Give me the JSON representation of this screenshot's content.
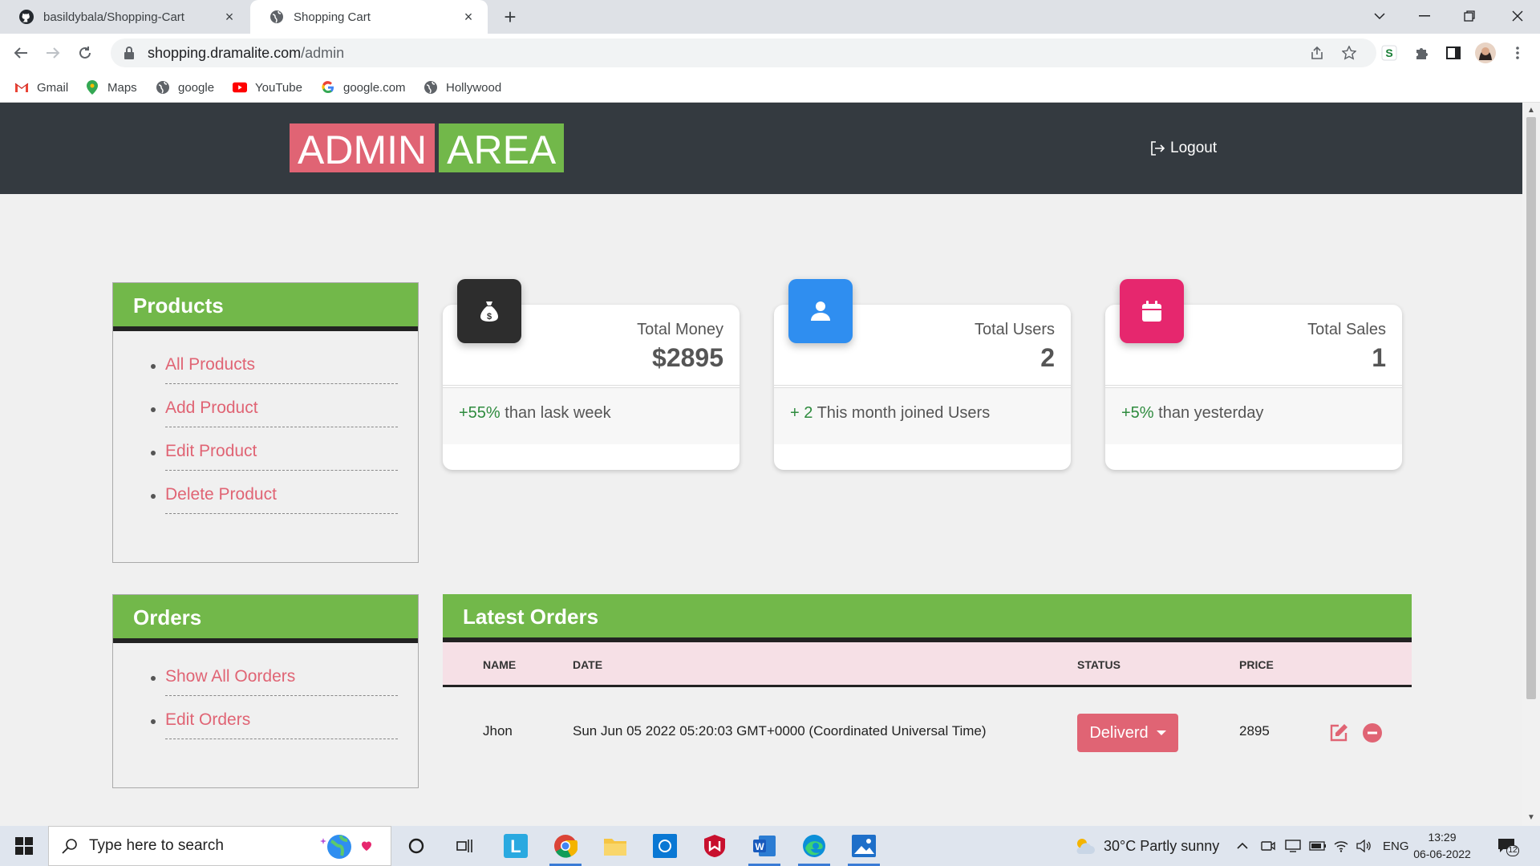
{
  "browser": {
    "tabs": [
      {
        "title": "basildybala/Shopping-Cart",
        "icon": "github-icon"
      },
      {
        "title": "Shopping Cart",
        "icon": "globe-icon",
        "active": true
      }
    ],
    "url_host": "shopping.dramalite.com",
    "url_path": "/admin",
    "bookmarks": [
      {
        "label": "Gmail",
        "icon": "gmail-icon"
      },
      {
        "label": "Maps",
        "icon": "maps-icon"
      },
      {
        "label": "google",
        "icon": "globe-icon"
      },
      {
        "label": "YouTube",
        "icon": "youtube-icon"
      },
      {
        "label": "google.com",
        "icon": "google-icon"
      },
      {
        "label": "Hollywood",
        "icon": "globe-icon"
      }
    ]
  },
  "header": {
    "brand_part1": "ADMIN",
    "brand_part2": "AREA",
    "logout_label": "Logout"
  },
  "products_panel": {
    "title": "Products",
    "items": [
      "All Products",
      "Add Product",
      "Edit Product",
      "Delete Product"
    ]
  },
  "orders_panel": {
    "title": "Orders",
    "items": [
      "Show All Oorders",
      "Edit Orders"
    ]
  },
  "stats": [
    {
      "label": "Total Money",
      "value": "$2895",
      "note_highlight": "+55%",
      "note_rest": "than lask week",
      "icon": "money-bag-icon",
      "color": "#2d2d2d"
    },
    {
      "label": "Total Users",
      "value": "2",
      "note_highlight": "+ 2",
      "note_rest": "This month joined Users",
      "icon": "user-icon",
      "color": "#2f8ef0"
    },
    {
      "label": "Total Sales",
      "value": "1",
      "note_highlight": "+5%",
      "note_rest": "than yesterday",
      "icon": "calendar-icon",
      "color": "#e6276e"
    }
  ],
  "latest_orders": {
    "title": "Latest Orders",
    "columns": [
      "NAME",
      "DATE",
      "STATUS",
      "PRICE"
    ],
    "rows": [
      {
        "name": "Jhon",
        "date": "Sun Jun 05 2022 05:20:03 GMT+0000 (Coordinated Universal Time)",
        "status": "Deliverd",
        "price": "2895"
      }
    ]
  },
  "taskbar": {
    "search_placeholder": "Type here to search",
    "weather": "30°C  Partly sunny",
    "language": "ENG",
    "time": "13:29",
    "date": "06-06-2022",
    "notification_count": "12"
  },
  "colors": {
    "accent_pink": "#e06474",
    "accent_green": "#72b84a",
    "header_dark": "#343a40",
    "positive_green": "#2e8b3e"
  }
}
